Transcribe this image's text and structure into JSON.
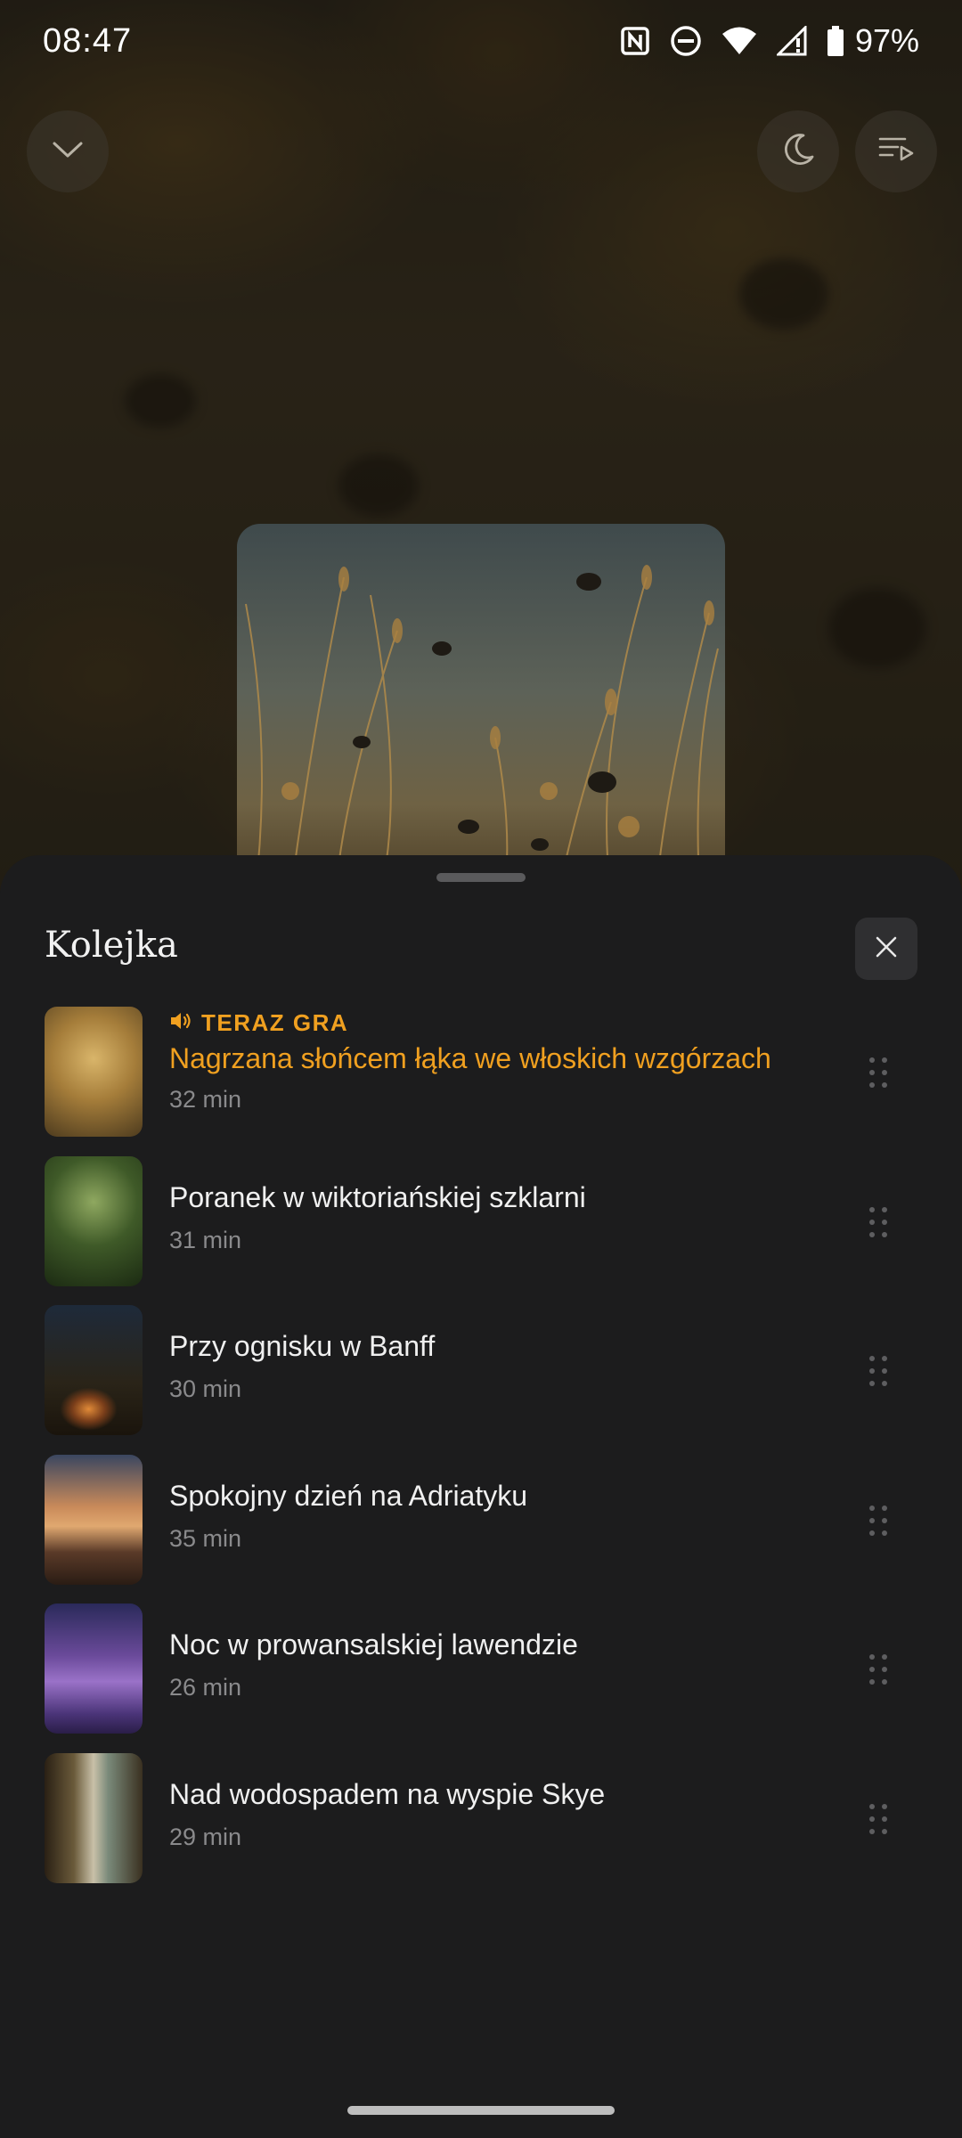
{
  "status_bar": {
    "time": "08:47",
    "battery": "97%",
    "icons": [
      "nfc-icon",
      "do-not-disturb-icon",
      "wifi-icon",
      "signal-icon",
      "battery-icon"
    ]
  },
  "player": {
    "collapse_icon": "chevron-down-icon",
    "sleep_timer_icon": "moon-icon",
    "queue_icon": "queue-icon"
  },
  "queue_sheet": {
    "title": "Kolejka",
    "close_icon": "close-icon",
    "now_playing_label": "TERAZ GRA",
    "items": [
      {
        "title": "Nagrzana słońcem łąka we włoskich wzgórzach",
        "duration": "32 min",
        "now_playing": true
      },
      {
        "title": "Poranek w wiktoriańskiej szklarni",
        "duration": "31 min"
      },
      {
        "title": "Przy ognisku w Banff",
        "duration": "30 min"
      },
      {
        "title": "Spokojny dzień na Adriatyku",
        "duration": "35 min"
      },
      {
        "title": "Noc w prowansalskiej lawendzie",
        "duration": "26 min"
      },
      {
        "title": "Nad wodospadem na wyspie Skye",
        "duration": "29 min"
      }
    ]
  },
  "colors": {
    "accent": "#f0a020",
    "sheet_background": "#1c1c1d",
    "secondary_text": "#8a8a8c"
  }
}
